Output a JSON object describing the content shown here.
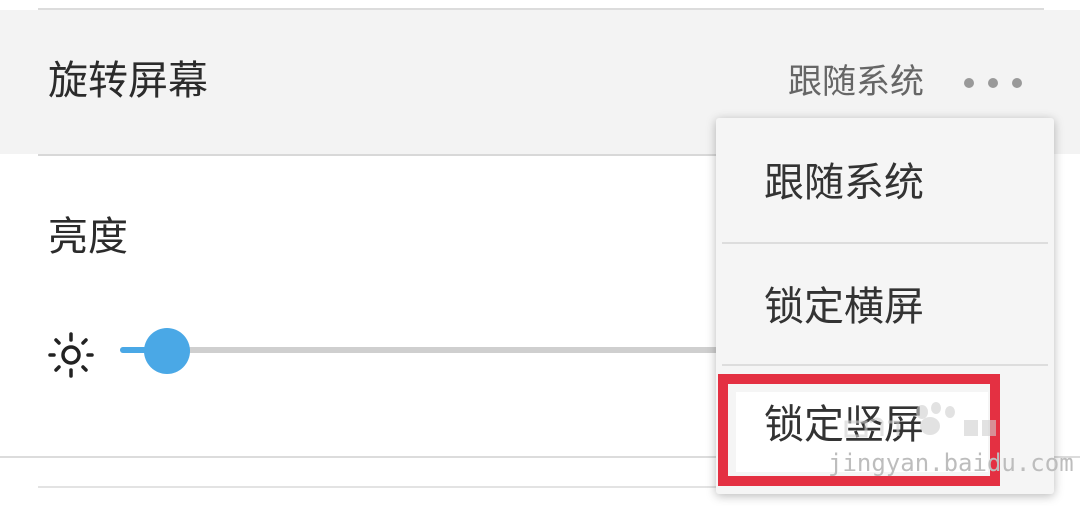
{
  "rotate_screen": {
    "title": "旋转屏幕",
    "current_value": "跟随系统",
    "more_icon": "more-dots-icon"
  },
  "brightness": {
    "title": "亮度",
    "icon": "sun-icon",
    "level_fraction": 0.06
  },
  "menu": {
    "items": [
      {
        "label": "跟随系统"
      },
      {
        "label": "锁定横屏"
      },
      {
        "label": "锁定竖屏"
      }
    ]
  },
  "highlight_color": "#e43042",
  "accent_color": "#4aa8e6",
  "watermark": {
    "text": "jingyan.baidu.com",
    "logo": "Baidu经验"
  }
}
